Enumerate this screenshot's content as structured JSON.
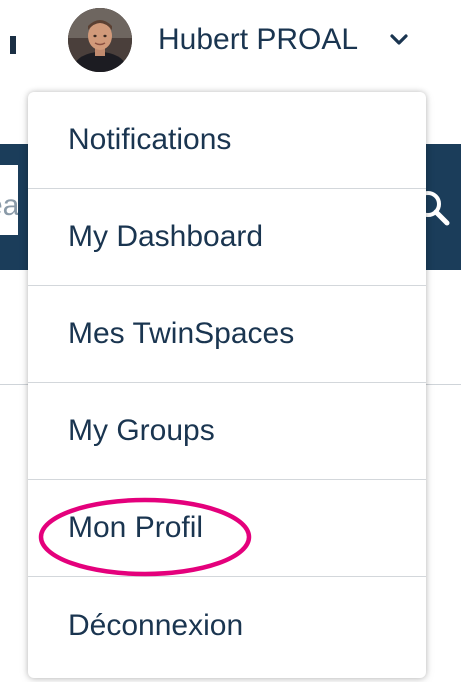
{
  "header": {
    "user_name": "Hubert PROAL",
    "avatar_icon": "user-photo-avatar",
    "chevron_icon": "chevron-down-icon"
  },
  "search": {
    "placeholder_fragment": "ea",
    "icon": "search-icon"
  },
  "user_menu": {
    "items": [
      {
        "label": "Notifications"
      },
      {
        "label": "My Dashboard"
      },
      {
        "label": "Mes TwinSpaces"
      },
      {
        "label": "My Groups"
      },
      {
        "label": "Mon Profil",
        "highlighted": true
      },
      {
        "label": "Déconnexion"
      }
    ]
  },
  "colors": {
    "text": "#1a3550",
    "band": "#1b3d5a",
    "highlight": "#e4007c",
    "divider": "#d3d7db"
  }
}
